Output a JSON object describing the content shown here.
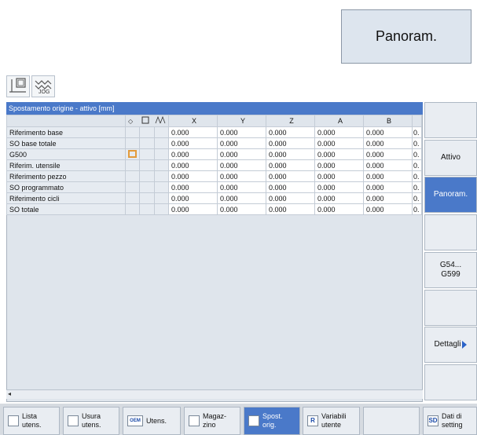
{
  "external_button": {
    "label": "Panoram."
  },
  "mode_icons": [
    "machine-icon",
    "jog-icon"
  ],
  "mode_icon_text": {
    "jog": "JOG"
  },
  "panel": {
    "title": "Spostamento origine - attivo   [mm]",
    "columns": [
      "X",
      "Y",
      "Z",
      "A",
      "B"
    ],
    "cut_col_value": "0.",
    "rows": [
      {
        "label": "Riferimento base",
        "values": [
          "0.000",
          "0.000",
          "0.000",
          "0.000",
          "0.000"
        ]
      },
      {
        "label": "SO base totale",
        "values": [
          "0.000",
          "0.000",
          "0.000",
          "0.000",
          "0.000"
        ]
      },
      {
        "label": "G500",
        "values": [
          "0.000",
          "0.000",
          "0.000",
          "0.000",
          "0.000"
        ]
      },
      {
        "label": "Riferim. utensile",
        "values": [
          "0.000",
          "0.000",
          "0.000",
          "0.000",
          "0.000"
        ]
      },
      {
        "label": "Riferimento pezzo",
        "values": [
          "0.000",
          "0.000",
          "0.000",
          "0.000",
          "0.000"
        ]
      },
      {
        "label": "SO programmato",
        "values": [
          "0.000",
          "0.000",
          "0.000",
          "0.000",
          "0.000"
        ]
      },
      {
        "label": "Riferimento cicli",
        "values": [
          "0.000",
          "0.000",
          "0.000",
          "0.000",
          "0.000"
        ]
      },
      {
        "label": "SO totale",
        "values": [
          "0.000",
          "0.000",
          "0.000",
          "0.000",
          "0.000"
        ]
      }
    ]
  },
  "right_softkeys": [
    {
      "label": ""
    },
    {
      "label": "Attivo"
    },
    {
      "label": "Panoram."
    },
    {
      "label": ""
    },
    {
      "label": "G54...\nG599"
    },
    {
      "label": ""
    },
    {
      "label": "Dettagli"
    },
    {
      "label": ""
    }
  ],
  "bottom_softkeys": [
    {
      "label": "Lista\nutens.",
      "icon": ""
    },
    {
      "label": "Usura\nutens.",
      "icon": ""
    },
    {
      "label": "Utens.",
      "icon": "OEM"
    },
    {
      "label": "Magaz-\nzino",
      "icon": ""
    },
    {
      "label": "Spost.\norig.",
      "icon": ""
    },
    {
      "label": "Variabili\nutente",
      "icon": "R"
    },
    {
      "label": "",
      "icon": ""
    },
    {
      "label": "Dati di\nsetting",
      "icon": "SD"
    }
  ],
  "colors": {
    "accent": "#4a79c9",
    "highlight": "#e39b3b"
  }
}
